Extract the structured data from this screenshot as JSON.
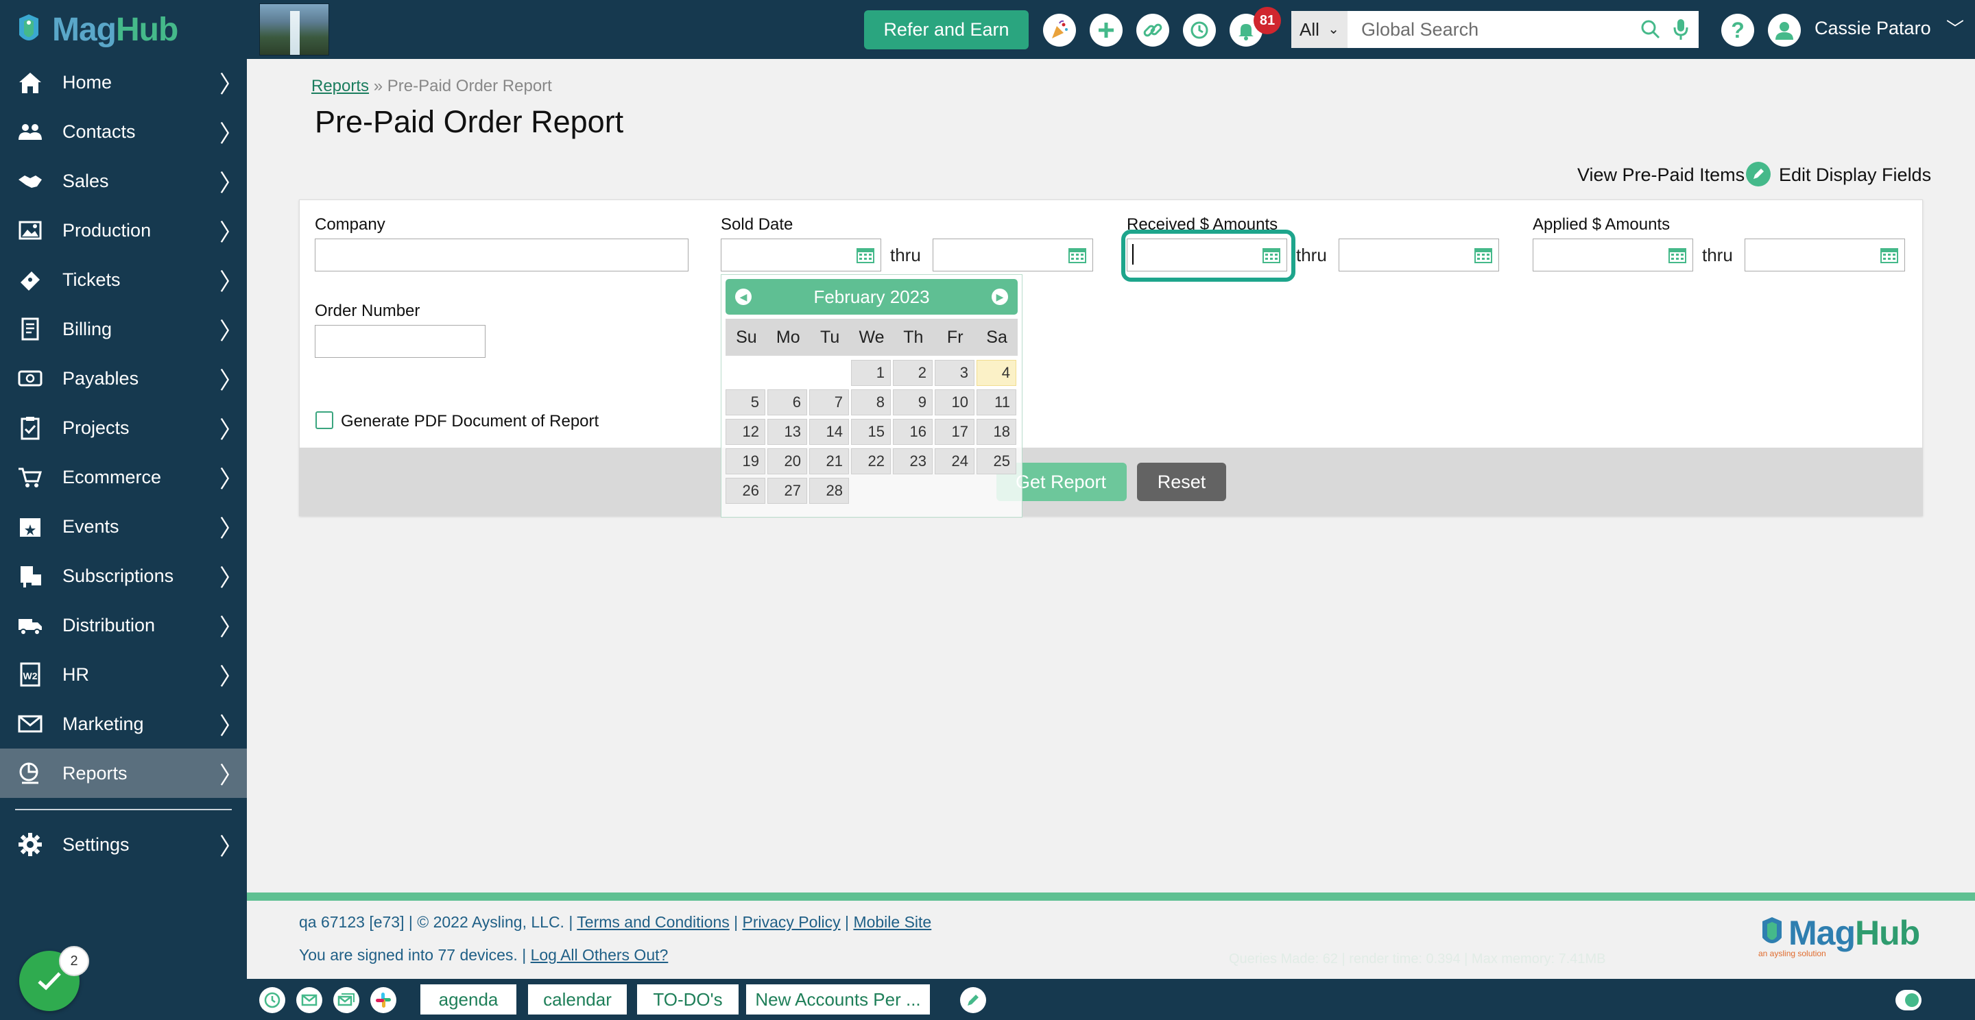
{
  "sidebar": {
    "brand_mag": "Mag",
    "brand_hub": "Hub",
    "items": [
      {
        "label": "Home",
        "icon": "home-icon"
      },
      {
        "label": "Contacts",
        "icon": "contacts-icon"
      },
      {
        "label": "Sales",
        "icon": "handshake-icon"
      },
      {
        "label": "Production",
        "icon": "image-icon"
      },
      {
        "label": "Tickets",
        "icon": "ticket-icon"
      },
      {
        "label": "Billing",
        "icon": "invoice-icon"
      },
      {
        "label": "Payables",
        "icon": "money-icon"
      },
      {
        "label": "Projects",
        "icon": "clipboard-check-icon"
      },
      {
        "label": "Ecommerce",
        "icon": "cart-icon"
      },
      {
        "label": "Events",
        "icon": "calendar-star-icon"
      },
      {
        "label": "Subscriptions",
        "icon": "subscriptions-icon"
      },
      {
        "label": "Distribution",
        "icon": "truck-icon"
      },
      {
        "label": "HR",
        "icon": "w2-form-icon"
      },
      {
        "label": "Marketing",
        "icon": "envelope-icon"
      },
      {
        "label": "Reports",
        "icon": "reports-icon",
        "active": true
      },
      {
        "label": "Settings",
        "icon": "gear-icon"
      }
    ],
    "tasks_count": "2"
  },
  "topbar": {
    "refer_label": "Refer and Earn",
    "notification_count": "81",
    "search_scope": "All",
    "search_placeholder": "Global Search",
    "user_name": "Cassie Pataro",
    "icons": [
      "party-popper-icon",
      "plus-icon",
      "link-icon",
      "history-icon",
      "bell-icon",
      "help-icon",
      "user-avatar-icon"
    ]
  },
  "page": {
    "breadcrumb_link": "Reports",
    "breadcrumb_sep": "»",
    "breadcrumb_current": "Pre-Paid Order Report",
    "title": "Pre-Paid Order Report",
    "view_prepaid": "View Pre-Paid Items",
    "edit_display": "Edit Display Fields"
  },
  "form": {
    "company_label": "Company",
    "sold_date_label": "Sold Date",
    "received_label": "Received $ Amounts",
    "applied_label": "Applied $ Amounts",
    "thru_label": "thru",
    "order_number_label": "Order Number",
    "pdf_label": "Generate PDF Document of Report",
    "get_report_label": "Get Report",
    "reset_label": "Reset"
  },
  "datepicker": {
    "month_label": "February 2023",
    "weekdays": [
      "Su",
      "Mo",
      "Tu",
      "We",
      "Th",
      "Fr",
      "Sa"
    ],
    "first_weekday_index": 3,
    "days_in_month": 28,
    "today": 4
  },
  "footer": {
    "build": "qa 67123 [e73] | © 2022 Aysling, LLC. |",
    "terms": "Terms and Conditions",
    "privacy": "Privacy Policy",
    "mobile": "Mobile Site",
    "signed_in": "You are signed into 77 devices. |",
    "logout_others": "Log All Others Out?",
    "debug": "Queries Made: 62 | render time: 0.394 | Max memory: 7.41MB",
    "logo_tag": "an aysling solution"
  },
  "bottombar": {
    "tabs": [
      "agenda",
      "calendar",
      "TO-DO's",
      "New Accounts Per ..."
    ]
  },
  "colors": {
    "sidebar": "#16394f",
    "accent": "#45b98a",
    "focus_ring": "#1ea58c",
    "badge": "#d0262e"
  }
}
